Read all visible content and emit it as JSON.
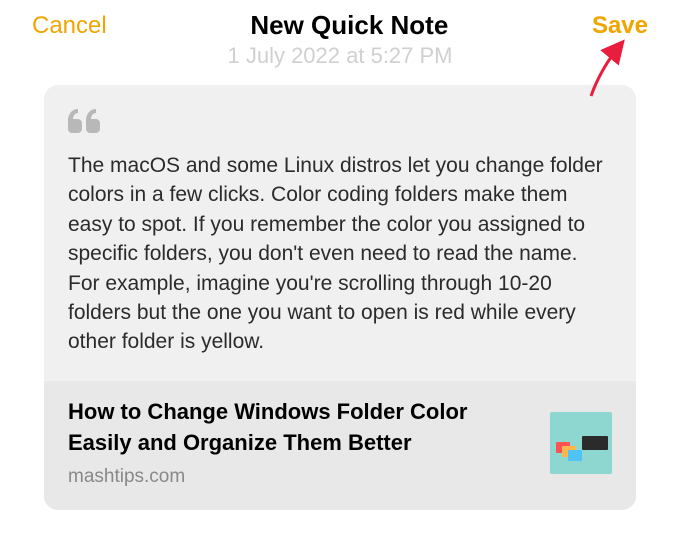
{
  "header": {
    "cancel_label": "Cancel",
    "title": "New Quick Note",
    "save_label": "Save"
  },
  "timestamp": "1 July 2022 at 5:27 PM",
  "note": {
    "quote_text": "The macOS and some Linux distros let you change folder colors in a few clicks. Color coding folders make them easy to spot. If you remember the color you assigned to specific folders, you don't even need to read the name. For example, imagine you're scrolling through 10-20 folders but the one you want to open is red while every other folder is yellow."
  },
  "link_preview": {
    "title": "How to Change Windows Folder Color Easily and Organize Them Better",
    "domain": "mashtips.com"
  }
}
